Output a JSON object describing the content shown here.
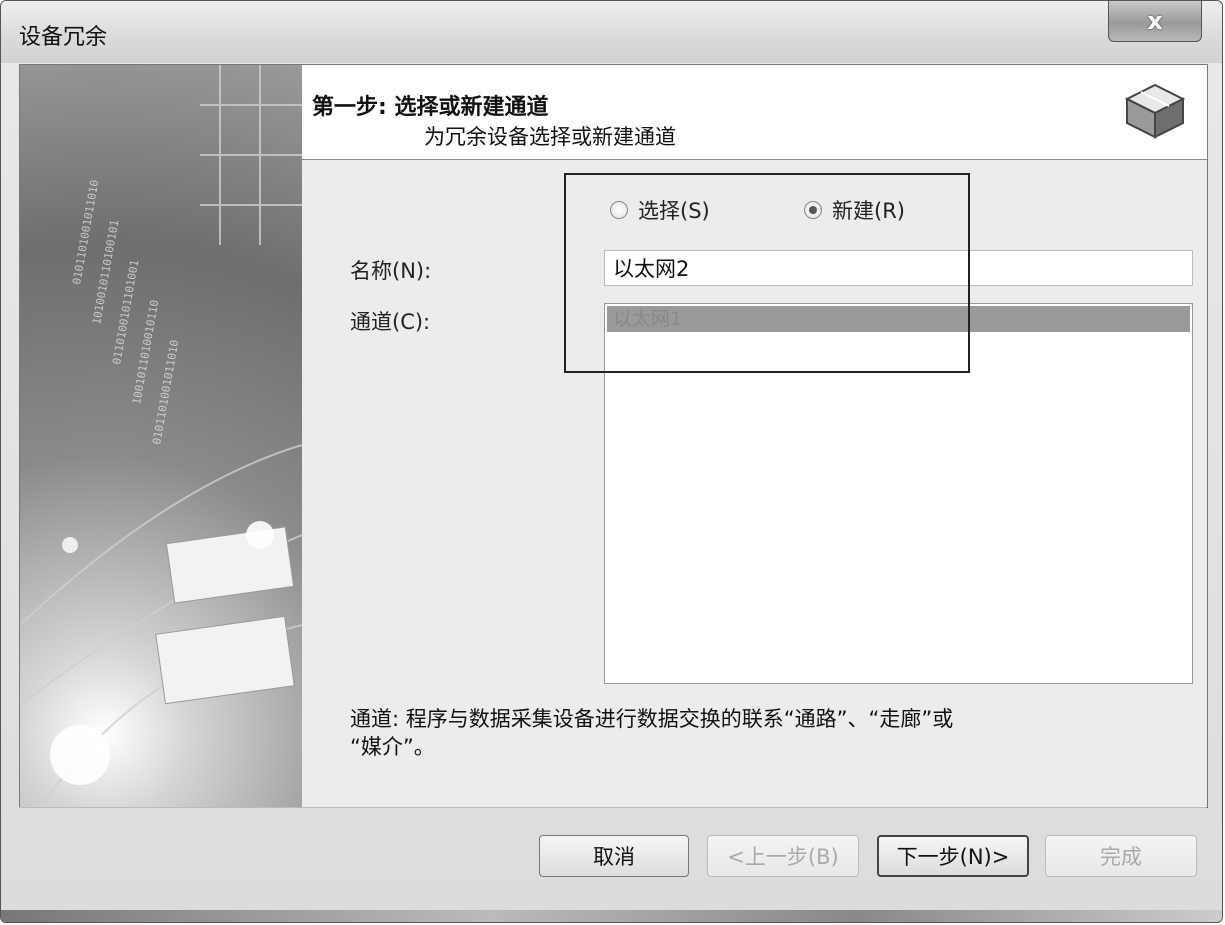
{
  "window": {
    "title": "设备冗余",
    "close_symbol": "x"
  },
  "header": {
    "step_title": "第一步: 选择或新建通道",
    "step_subtitle": "为冗余设备选择或新建通道",
    "icon": "wizard-box-icon"
  },
  "radios": {
    "select_label": "选择(S)",
    "new_label": "新建(R)",
    "selected": "new"
  },
  "form": {
    "name_label": "名称(N):",
    "name_value": "以太网2",
    "channel_label": "通道(C):",
    "channel_items": [
      "以太网1"
    ]
  },
  "description": {
    "line1": "通道: 程序与数据采集设备进行数据交换的联系“通路”、“走廊”或",
    "line2": "“媒介”。"
  },
  "buttons": {
    "cancel": "取消",
    "back": "<上一步(B)",
    "next": "下一步(N)>",
    "finish": "完成"
  }
}
